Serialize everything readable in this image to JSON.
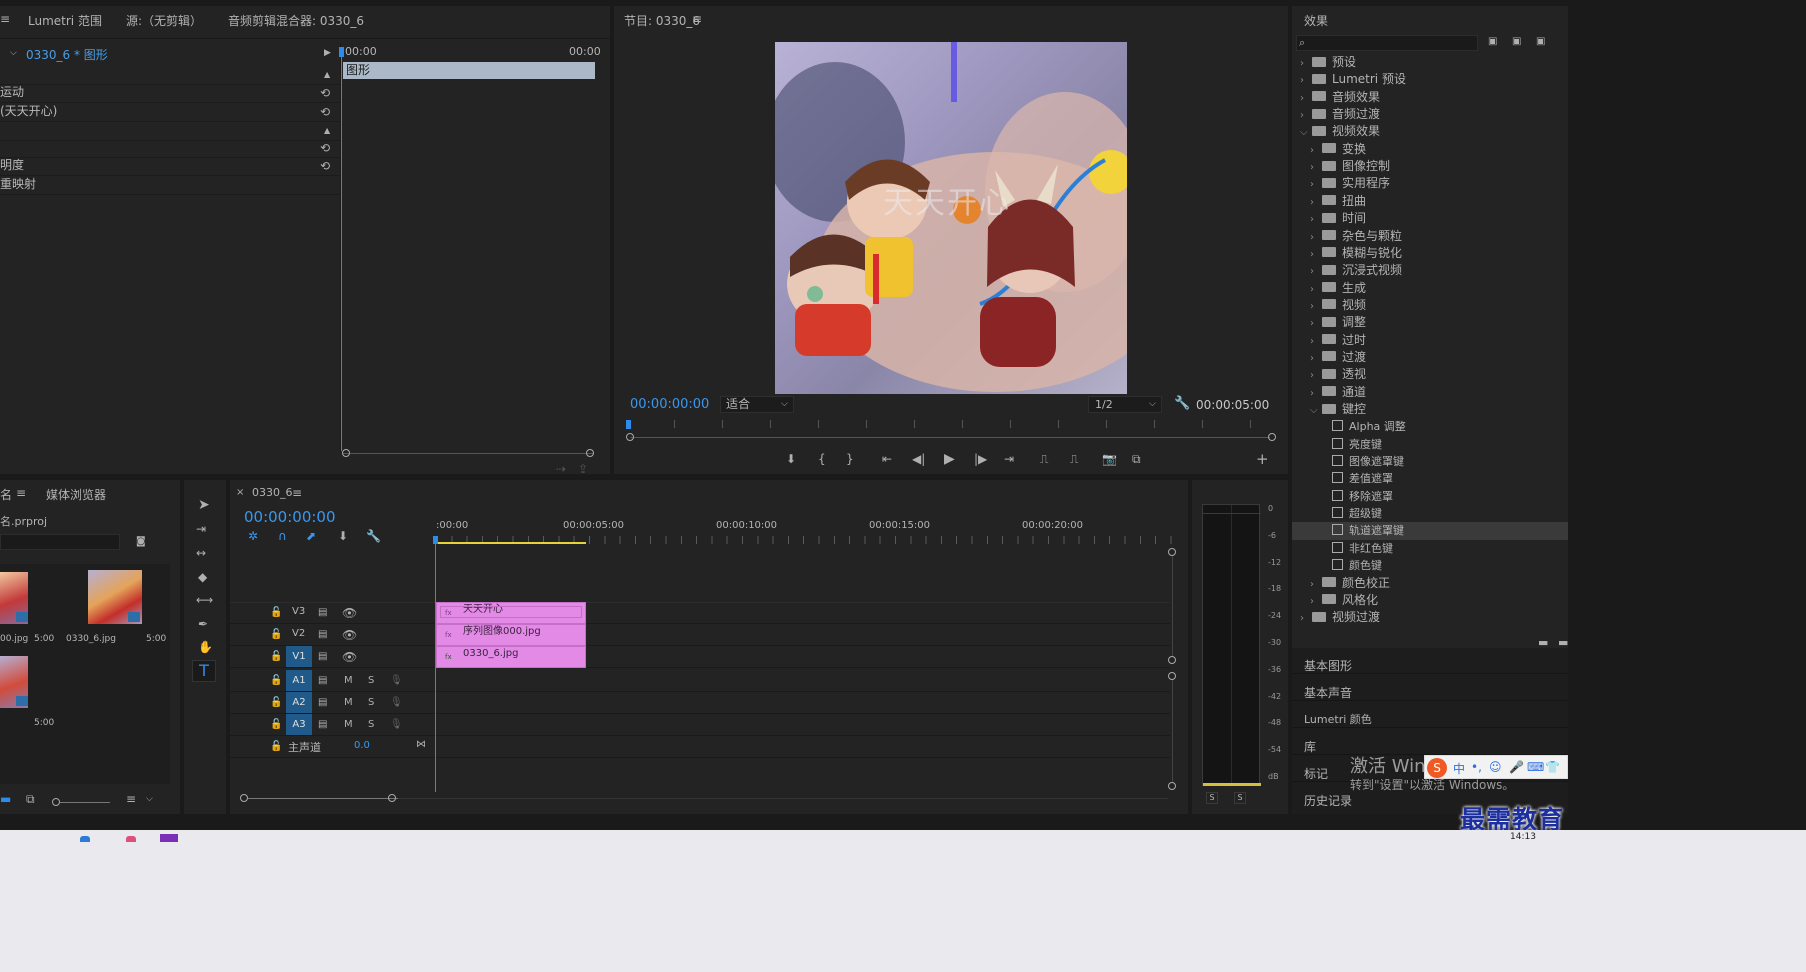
{
  "top_tabs": {
    "lumetri": "Lumetri 范围",
    "source": "源:（无剪辑）",
    "mixer": "音频剪辑混合器: 0330_6"
  },
  "effect_controls": {
    "clip_path": "0330_6 * 图形",
    "time_start": "00:00",
    "time_end": "00:00",
    "clip_bar_label": "图形",
    "rows": [
      "运动",
      "(天天开心)",
      "",
      "",
      "明度",
      "重映射"
    ]
  },
  "program": {
    "title": "节目: 0330_6",
    "timecode": "00:00:00:00",
    "fit": "适合",
    "quality": "1/2",
    "duration": "00:00:05:00",
    "overlay_text": "天天开心"
  },
  "effects": {
    "title": "效果",
    "items": [
      {
        "label": "预设",
        "level": 0,
        "type": "folder",
        "expanded": false
      },
      {
        "label": "Lumetri 预设",
        "level": 0,
        "type": "folder",
        "expanded": false
      },
      {
        "label": "音频效果",
        "level": 0,
        "type": "folder",
        "expanded": false
      },
      {
        "label": "音频过渡",
        "level": 0,
        "type": "folder",
        "expanded": false
      },
      {
        "label": "视频效果",
        "level": 0,
        "type": "folder",
        "expanded": true
      },
      {
        "label": "变换",
        "level": 1,
        "type": "folder",
        "expanded": false
      },
      {
        "label": "图像控制",
        "level": 1,
        "type": "folder",
        "expanded": false
      },
      {
        "label": "实用程序",
        "level": 1,
        "type": "folder",
        "expanded": false
      },
      {
        "label": "扭曲",
        "level": 1,
        "type": "folder",
        "expanded": false
      },
      {
        "label": "时间",
        "level": 1,
        "type": "folder",
        "expanded": false
      },
      {
        "label": "杂色与颗粒",
        "level": 1,
        "type": "folder",
        "expanded": false
      },
      {
        "label": "模糊与锐化",
        "level": 1,
        "type": "folder",
        "expanded": false
      },
      {
        "label": "沉浸式视频",
        "level": 1,
        "type": "folder",
        "expanded": false
      },
      {
        "label": "生成",
        "level": 1,
        "type": "folder",
        "expanded": false
      },
      {
        "label": "视频",
        "level": 1,
        "type": "folder",
        "expanded": false
      },
      {
        "label": "调整",
        "level": 1,
        "type": "folder",
        "expanded": false
      },
      {
        "label": "过时",
        "level": 1,
        "type": "folder",
        "expanded": false
      },
      {
        "label": "过渡",
        "level": 1,
        "type": "folder",
        "expanded": false
      },
      {
        "label": "透视",
        "level": 1,
        "type": "folder",
        "expanded": false
      },
      {
        "label": "通道",
        "level": 1,
        "type": "folder",
        "expanded": false
      },
      {
        "label": "键控",
        "level": 1,
        "type": "folder",
        "expanded": true
      },
      {
        "label": "Alpha 调整",
        "level": 2,
        "type": "effect"
      },
      {
        "label": "亮度键",
        "level": 2,
        "type": "effect"
      },
      {
        "label": "图像遮罩键",
        "level": 2,
        "type": "effect"
      },
      {
        "label": "差值遮罩",
        "level": 2,
        "type": "effect"
      },
      {
        "label": "移除遮罩",
        "level": 2,
        "type": "effect"
      },
      {
        "label": "超级键",
        "level": 2,
        "type": "effect"
      },
      {
        "label": "轨道遮罩键",
        "level": 2,
        "type": "effect",
        "selected": true
      },
      {
        "label": "非红色键",
        "level": 2,
        "type": "effect"
      },
      {
        "label": "颜色键",
        "level": 2,
        "type": "effect"
      },
      {
        "label": "颜色校正",
        "level": 1,
        "type": "folder",
        "expanded": false
      },
      {
        "label": "风格化",
        "level": 1,
        "type": "folder",
        "expanded": false
      },
      {
        "label": "视频过渡",
        "level": 0,
        "type": "folder",
        "expanded": false
      }
    ]
  },
  "side_panels": [
    "基本图形",
    "基本声音",
    "Lumetri 颜色",
    "库",
    "标记",
    "历史记录"
  ],
  "project": {
    "tab_name": "名",
    "tab_media": "媒体浏览器",
    "file": "名.prproj",
    "thumbs": [
      {
        "name": "00.jpg",
        "dur": "5:00"
      },
      {
        "name": "0330_6.jpg",
        "dur": "5:00"
      },
      {
        "name": "",
        "dur": "5:00"
      }
    ]
  },
  "timeline": {
    "tab": "0330_6",
    "timecode": "00:00:00:00",
    "ruler": [
      ":00:00",
      "00:00:05:00",
      "00:00:10:00",
      "00:00:15:00",
      "00:00:20:00"
    ],
    "video_tracks": [
      "V3",
      "V2",
      "V1"
    ],
    "audio_tracks": [
      "A1",
      "A2",
      "A3"
    ],
    "master_label": "主声道",
    "master_value": "0.0",
    "clips": [
      "天天开心",
      "序列图像000.jpg",
      "0330_6.jpg"
    ]
  },
  "meter": {
    "scale": [
      "0",
      "-6",
      "-12",
      "-18",
      "-24",
      "-30",
      "-36",
      "-42",
      "-48",
      "-54",
      "dB"
    ],
    "solo_left": "S",
    "solo_right": "S"
  },
  "activate": {
    "line1": "激活 Windows",
    "line2": "转到\"设置\"以激活 Windows。"
  },
  "watermark": "最需教育",
  "clock": "14:13"
}
